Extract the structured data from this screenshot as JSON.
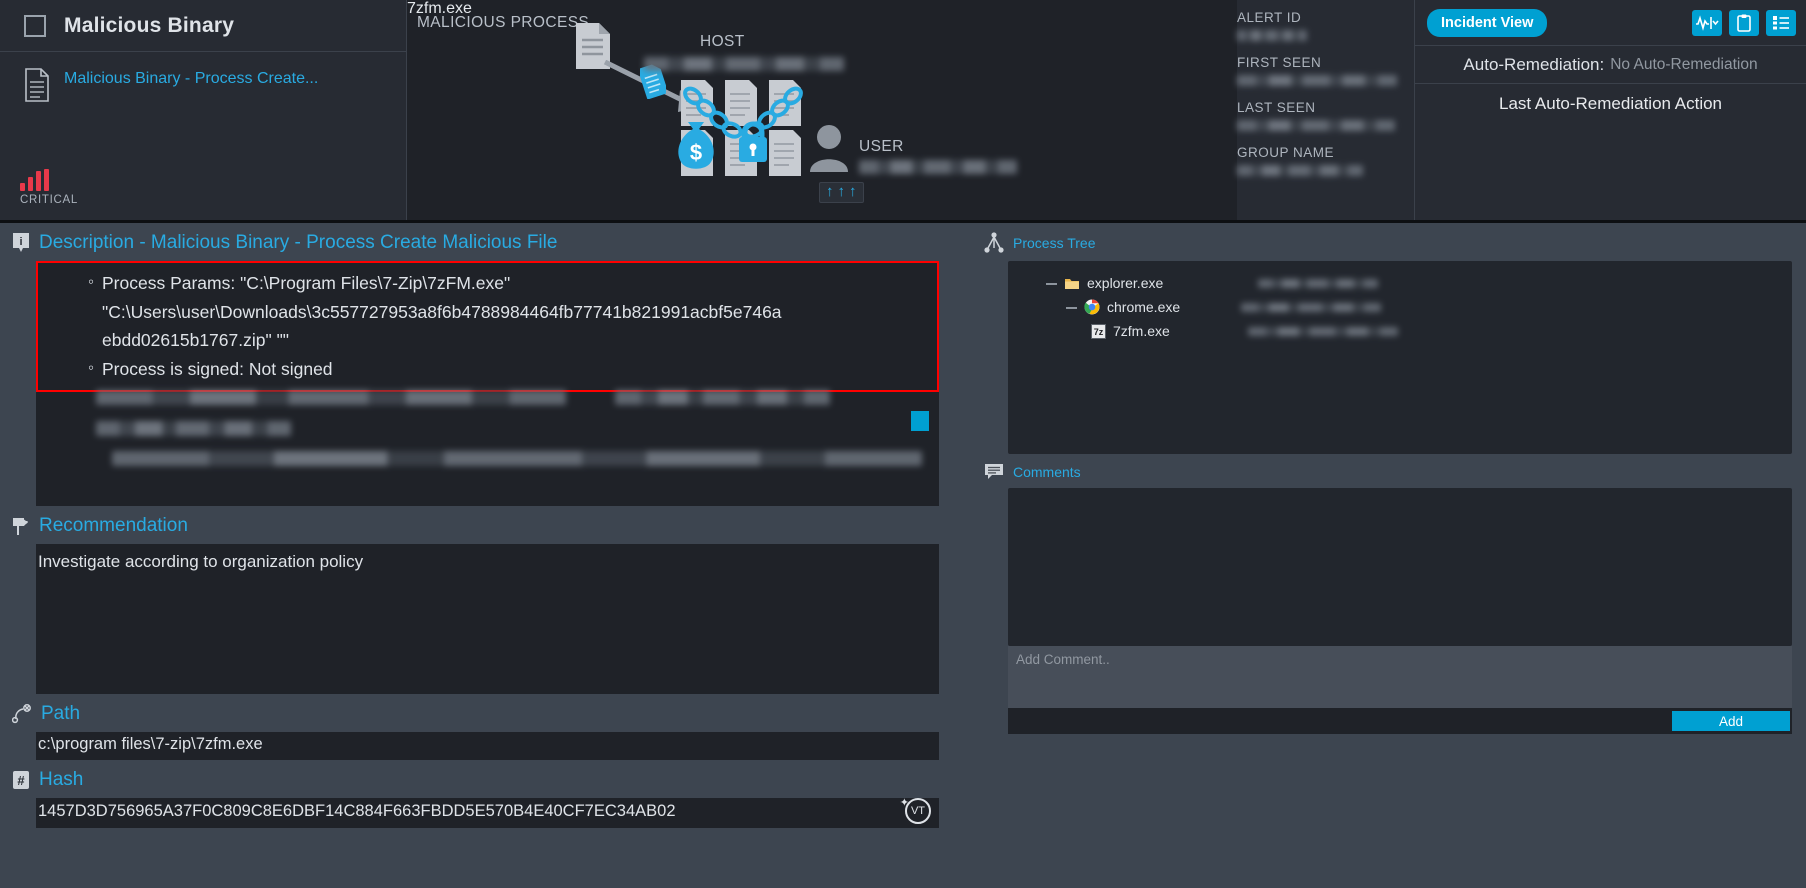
{
  "alert": {
    "title": "Malicious Binary",
    "subtitle": "Malicious Binary - Process Create...",
    "severity_label": "CRITICAL",
    "severity_color": "#e8394a"
  },
  "diagram": {
    "malicious_process_label": "MALICIOUS PROCESS",
    "malicious_process_value": "7zfm.exe",
    "host_label": "HOST",
    "host_value": "",
    "user_label": "USER",
    "user_value": "",
    "escalation_arrows": [
      "↑",
      "↑",
      "↑"
    ]
  },
  "meta": [
    {
      "key": "ALERT ID",
      "value": ""
    },
    {
      "key": "FIRST SEEN",
      "value": ""
    },
    {
      "key": "LAST SEEN",
      "value": ""
    },
    {
      "key": "GROUP NAME",
      "value": ""
    }
  ],
  "actions": {
    "incident_view_label": "Incident View",
    "accent_color": "#00a0d2",
    "icons": [
      "activity-chart-dropdown-icon",
      "clipboard-icon",
      "list-icon"
    ],
    "auto_remediation_key": "Auto-Remediation:",
    "auto_remediation_value": "No Auto-Remediation",
    "last_action_label": "Last Auto-Remediation Action"
  },
  "description": {
    "title": "Description - Malicious Binary - Process Create Malicious File",
    "highlight_color": "#ff0000",
    "items": [
      "Process Params: \"C:\\Program Files\\7-Zip\\7zFM.exe\"",
      "\"C:\\Users\\user\\Downloads\\3c557727953a8f6b4788984464fb77741b821991acbf5e746a",
      "ebdd02615b1767.zip\" \"\"",
      "Process is signed: Not signed"
    ]
  },
  "recommendation": {
    "title": "Recommendation",
    "text": "Investigate according to organization policy"
  },
  "path": {
    "title": "Path",
    "value": "c:\\program files\\7-zip\\7zfm.exe"
  },
  "hash": {
    "title": "Hash",
    "value": "1457D3D756965A37F0C809C8E6DBF14C884F663FBDD5E570B4E40CF7EC34AB02",
    "vt_badge": "VT"
  },
  "process_tree": {
    "title": "Process Tree",
    "nodes": [
      {
        "name": "explorer.exe",
        "icon": "folder-icon",
        "depth": 0
      },
      {
        "name": "chrome.exe",
        "icon": "chrome-icon",
        "depth": 1
      },
      {
        "name": "7zfm.exe",
        "icon": "sevenzip-icon",
        "depth": 2
      }
    ]
  },
  "comments": {
    "title": "Comments",
    "input_placeholder": "Add Comment..",
    "input_value": "",
    "add_label": "Add"
  }
}
